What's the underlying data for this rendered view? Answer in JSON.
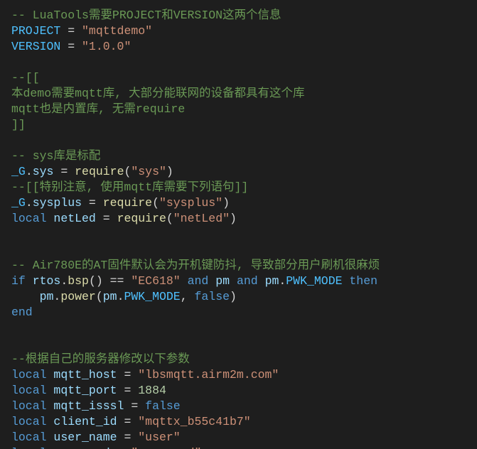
{
  "code": {
    "lines": [
      [
        {
          "cls": "cm",
          "t": "-- LuaTools需要PROJECT和VERSION这两个信息"
        }
      ],
      [
        {
          "cls": "va",
          "t": "PROJECT"
        },
        {
          "cls": "op",
          "t": " = "
        },
        {
          "cls": "str",
          "t": "\"mqttdemo\""
        }
      ],
      [
        {
          "cls": "va",
          "t": "VERSION"
        },
        {
          "cls": "op",
          "t": " = "
        },
        {
          "cls": "str",
          "t": "\"1.0.0\""
        }
      ],
      [],
      [
        {
          "cls": "cm",
          "t": "--[["
        }
      ],
      [
        {
          "cls": "cm",
          "t": "本demo需要mqtt库, 大部分能联网的设备都具有这个库"
        }
      ],
      [
        {
          "cls": "cm",
          "t": "mqtt也是内置库, 无需require"
        }
      ],
      [
        {
          "cls": "cm",
          "t": "]]"
        }
      ],
      [],
      [
        {
          "cls": "cm",
          "t": "-- sys库是标配"
        }
      ],
      [
        {
          "cls": "va",
          "t": "_G"
        },
        {
          "cls": "op",
          "t": "."
        },
        {
          "cls": "vl",
          "t": "sys"
        },
        {
          "cls": "op",
          "t": " = "
        },
        {
          "cls": "fn",
          "t": "require"
        },
        {
          "cls": "op",
          "t": "("
        },
        {
          "cls": "str",
          "t": "\"sys\""
        },
        {
          "cls": "op",
          "t": ")"
        }
      ],
      [
        {
          "cls": "cm",
          "t": "--[[特别注意, 使用mqtt库需要下列语句]]"
        }
      ],
      [
        {
          "cls": "va",
          "t": "_G"
        },
        {
          "cls": "op",
          "t": "."
        },
        {
          "cls": "vl",
          "t": "sysplus"
        },
        {
          "cls": "op",
          "t": " = "
        },
        {
          "cls": "fn",
          "t": "require"
        },
        {
          "cls": "op",
          "t": "("
        },
        {
          "cls": "str",
          "t": "\"sysplus\""
        },
        {
          "cls": "op",
          "t": ")"
        }
      ],
      [
        {
          "cls": "kw",
          "t": "local"
        },
        {
          "cls": "op",
          "t": " "
        },
        {
          "cls": "vl",
          "t": "netLed"
        },
        {
          "cls": "op",
          "t": " = "
        },
        {
          "cls": "fn",
          "t": "require"
        },
        {
          "cls": "op",
          "t": "("
        },
        {
          "cls": "str",
          "t": "\"netLed\""
        },
        {
          "cls": "op",
          "t": ")"
        }
      ],
      [],
      [],
      [
        {
          "cls": "cm",
          "t": "-- Air780E的AT固件默认会为开机键防抖, 导致部分用户刷机很麻烦"
        }
      ],
      [
        {
          "cls": "kw",
          "t": "if"
        },
        {
          "cls": "op",
          "t": " "
        },
        {
          "cls": "vl",
          "t": "rtos"
        },
        {
          "cls": "op",
          "t": "."
        },
        {
          "cls": "fn",
          "t": "bsp"
        },
        {
          "cls": "op",
          "t": "() == "
        },
        {
          "cls": "str",
          "t": "\"EC618\""
        },
        {
          "cls": "op",
          "t": " "
        },
        {
          "cls": "kw",
          "t": "and"
        },
        {
          "cls": "op",
          "t": " "
        },
        {
          "cls": "vl",
          "t": "pm"
        },
        {
          "cls": "op",
          "t": " "
        },
        {
          "cls": "kw",
          "t": "and"
        },
        {
          "cls": "op",
          "t": " "
        },
        {
          "cls": "vl",
          "t": "pm"
        },
        {
          "cls": "op",
          "t": "."
        },
        {
          "cls": "cn",
          "t": "PWK_MODE"
        },
        {
          "cls": "op",
          "t": " "
        },
        {
          "cls": "kw",
          "t": "then"
        }
      ],
      [
        {
          "cls": "op",
          "t": "    "
        },
        {
          "cls": "vl",
          "t": "pm"
        },
        {
          "cls": "op",
          "t": "."
        },
        {
          "cls": "fn",
          "t": "power"
        },
        {
          "cls": "op",
          "t": "("
        },
        {
          "cls": "vl",
          "t": "pm"
        },
        {
          "cls": "op",
          "t": "."
        },
        {
          "cls": "cn",
          "t": "PWK_MODE"
        },
        {
          "cls": "op",
          "t": ", "
        },
        {
          "cls": "kc",
          "t": "false"
        },
        {
          "cls": "op",
          "t": ")"
        }
      ],
      [
        {
          "cls": "kw",
          "t": "end"
        }
      ],
      [],
      [],
      [
        {
          "cls": "cm",
          "t": "--根据自己的服务器修改以下参数"
        }
      ],
      [
        {
          "cls": "kw",
          "t": "local"
        },
        {
          "cls": "op",
          "t": " "
        },
        {
          "cls": "vl",
          "t": "mqtt_host"
        },
        {
          "cls": "op",
          "t": " = "
        },
        {
          "cls": "str",
          "t": "\"lbsmqtt.airm2m.com\""
        }
      ],
      [
        {
          "cls": "kw",
          "t": "local"
        },
        {
          "cls": "op",
          "t": " "
        },
        {
          "cls": "vl",
          "t": "mqtt_port"
        },
        {
          "cls": "op",
          "t": " = "
        },
        {
          "cls": "num",
          "t": "1884"
        }
      ],
      [
        {
          "cls": "kw",
          "t": "local"
        },
        {
          "cls": "op",
          "t": " "
        },
        {
          "cls": "vl",
          "t": "mqtt_isssl"
        },
        {
          "cls": "op",
          "t": " = "
        },
        {
          "cls": "kc",
          "t": "false"
        }
      ],
      [
        {
          "cls": "kw",
          "t": "local"
        },
        {
          "cls": "op",
          "t": " "
        },
        {
          "cls": "vl",
          "t": "client_id"
        },
        {
          "cls": "op",
          "t": " = "
        },
        {
          "cls": "str",
          "t": "\"mqttx_b55c41b7\""
        }
      ],
      [
        {
          "cls": "kw",
          "t": "local"
        },
        {
          "cls": "op",
          "t": " "
        },
        {
          "cls": "vl",
          "t": "user_name"
        },
        {
          "cls": "op",
          "t": " = "
        },
        {
          "cls": "str",
          "t": "\"user\""
        }
      ],
      [
        {
          "cls": "kw",
          "t": "local"
        },
        {
          "cls": "op",
          "t": " "
        },
        {
          "cls": "vl",
          "t": "password"
        },
        {
          "cls": "op",
          "t": " = "
        },
        {
          "cls": "str",
          "t": "\"password\""
        }
      ]
    ]
  }
}
